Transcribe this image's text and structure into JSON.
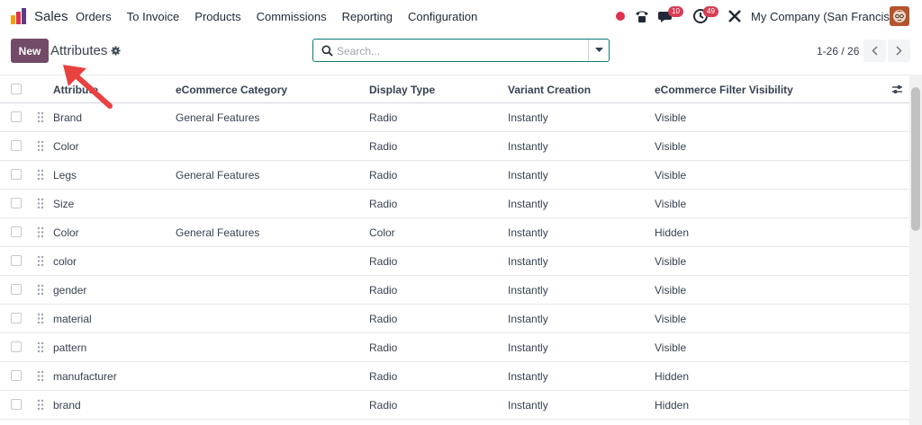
{
  "navbar": {
    "app_name": "Sales",
    "menu": [
      "Orders",
      "To Invoice",
      "Products",
      "Commissions",
      "Reporting",
      "Configuration"
    ],
    "chat_badge": "10",
    "activity_badge": "49",
    "company": "My Company (San Francisco)",
    "accent_color": "#714b67"
  },
  "control_panel": {
    "new_label": "New",
    "title": "Attributes",
    "search_placeholder": "Search...",
    "pager": "1-26 / 26"
  },
  "table": {
    "columns": [
      "Attribute",
      "eCommerce Category",
      "Display Type",
      "Variant Creation",
      "eCommerce Filter Visibility"
    ],
    "rows": [
      {
        "attribute": "Brand",
        "category": "General Features",
        "display": "Radio",
        "variant": "Instantly",
        "visibility": "Visible"
      },
      {
        "attribute": "Color",
        "category": "",
        "display": "Radio",
        "variant": "Instantly",
        "visibility": "Visible"
      },
      {
        "attribute": "Legs",
        "category": "General Features",
        "display": "Radio",
        "variant": "Instantly",
        "visibility": "Visible"
      },
      {
        "attribute": "Size",
        "category": "",
        "display": "Radio",
        "variant": "Instantly",
        "visibility": "Visible"
      },
      {
        "attribute": "Color",
        "category": "General Features",
        "display": "Color",
        "variant": "Instantly",
        "visibility": "Hidden"
      },
      {
        "attribute": "color",
        "category": "",
        "display": "Radio",
        "variant": "Instantly",
        "visibility": "Visible"
      },
      {
        "attribute": "gender",
        "category": "",
        "display": "Radio",
        "variant": "Instantly",
        "visibility": "Visible"
      },
      {
        "attribute": "material",
        "category": "",
        "display": "Radio",
        "variant": "Instantly",
        "visibility": "Visible"
      },
      {
        "attribute": "pattern",
        "category": "",
        "display": "Radio",
        "variant": "Instantly",
        "visibility": "Visible"
      },
      {
        "attribute": "manufacturer",
        "category": "",
        "display": "Radio",
        "variant": "Instantly",
        "visibility": "Hidden"
      },
      {
        "attribute": "brand",
        "category": "",
        "display": "Radio",
        "variant": "Instantly",
        "visibility": "Hidden"
      }
    ]
  }
}
